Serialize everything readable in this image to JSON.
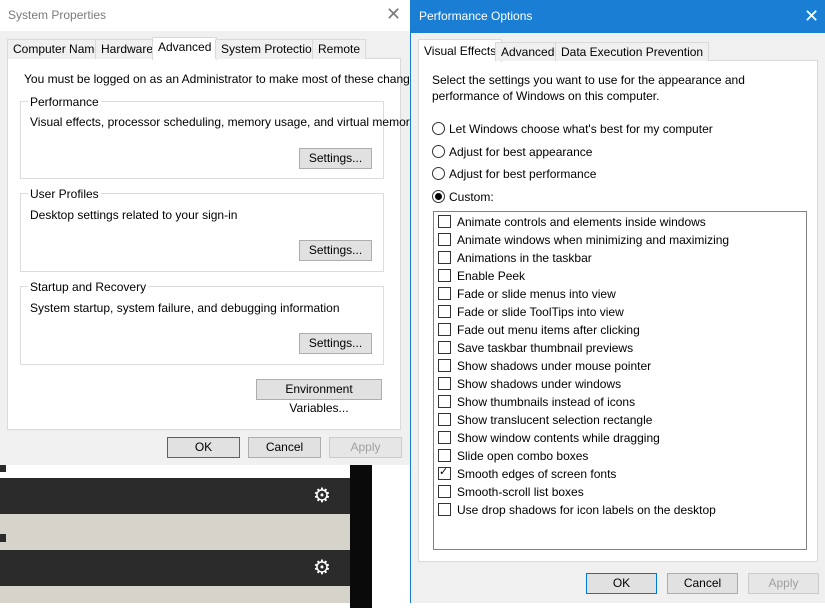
{
  "system_properties": {
    "title": "System Properties",
    "tabs": [
      "Computer Name",
      "Hardware",
      "Advanced",
      "System Protection",
      "Remote"
    ],
    "active_tab": "Advanced",
    "admin_note": "You must be logged on as an Administrator to make most of these changes.",
    "groups": [
      {
        "label": "Performance",
        "description": "Visual effects, processor scheduling, memory usage, and virtual memory",
        "button": "Settings..."
      },
      {
        "label": "User Profiles",
        "description": "Desktop settings related to your sign-in",
        "button": "Settings..."
      },
      {
        "label": "Startup and Recovery",
        "description": "System startup, system failure, and debugging information",
        "button": "Settings..."
      }
    ],
    "env_button": "Environment Variables...",
    "ok": "OK",
    "cancel": "Cancel",
    "apply": "Apply"
  },
  "performance_options": {
    "title": "Performance Options",
    "tabs": [
      "Visual Effects",
      "Advanced",
      "Data Execution Prevention"
    ],
    "active_tab": "Visual Effects",
    "intro": "Select the settings you want to use for the appearance and performance of Windows on this computer.",
    "radios": [
      {
        "label": "Let Windows choose what's best for my computer",
        "selected": false
      },
      {
        "label": "Adjust for best appearance",
        "selected": false
      },
      {
        "label": "Adjust for best performance",
        "selected": false
      },
      {
        "label": "Custom:",
        "selected": true
      }
    ],
    "effects": [
      {
        "label": "Animate controls and elements inside windows",
        "checked": false
      },
      {
        "label": "Animate windows when minimizing and maximizing",
        "checked": false
      },
      {
        "label": "Animations in the taskbar",
        "checked": false
      },
      {
        "label": "Enable Peek",
        "checked": false
      },
      {
        "label": "Fade or slide menus into view",
        "checked": false
      },
      {
        "label": "Fade or slide ToolTips into view",
        "checked": false
      },
      {
        "label": "Fade out menu items after clicking",
        "checked": false
      },
      {
        "label": "Save taskbar thumbnail previews",
        "checked": false
      },
      {
        "label": "Show shadows under mouse pointer",
        "checked": false
      },
      {
        "label": "Show shadows under windows",
        "checked": false
      },
      {
        "label": "Show thumbnails instead of icons",
        "checked": false
      },
      {
        "label": "Show translucent selection rectangle",
        "checked": false
      },
      {
        "label": "Show window contents while dragging",
        "checked": false
      },
      {
        "label": "Slide open combo boxes",
        "checked": false
      },
      {
        "label": "Smooth edges of screen fonts",
        "checked": true
      },
      {
        "label": "Smooth-scroll list boxes",
        "checked": false
      },
      {
        "label": "Use drop shadows for icon labels on the desktop",
        "checked": false
      }
    ],
    "ok": "OK",
    "cancel": "Cancel",
    "apply": "Apply"
  },
  "background": {
    "icons": [
      "gear-icon",
      "gear-icon"
    ]
  },
  "colors": {
    "accent": "#1a7fd4",
    "dialog_bg": "#f0f0f0"
  }
}
